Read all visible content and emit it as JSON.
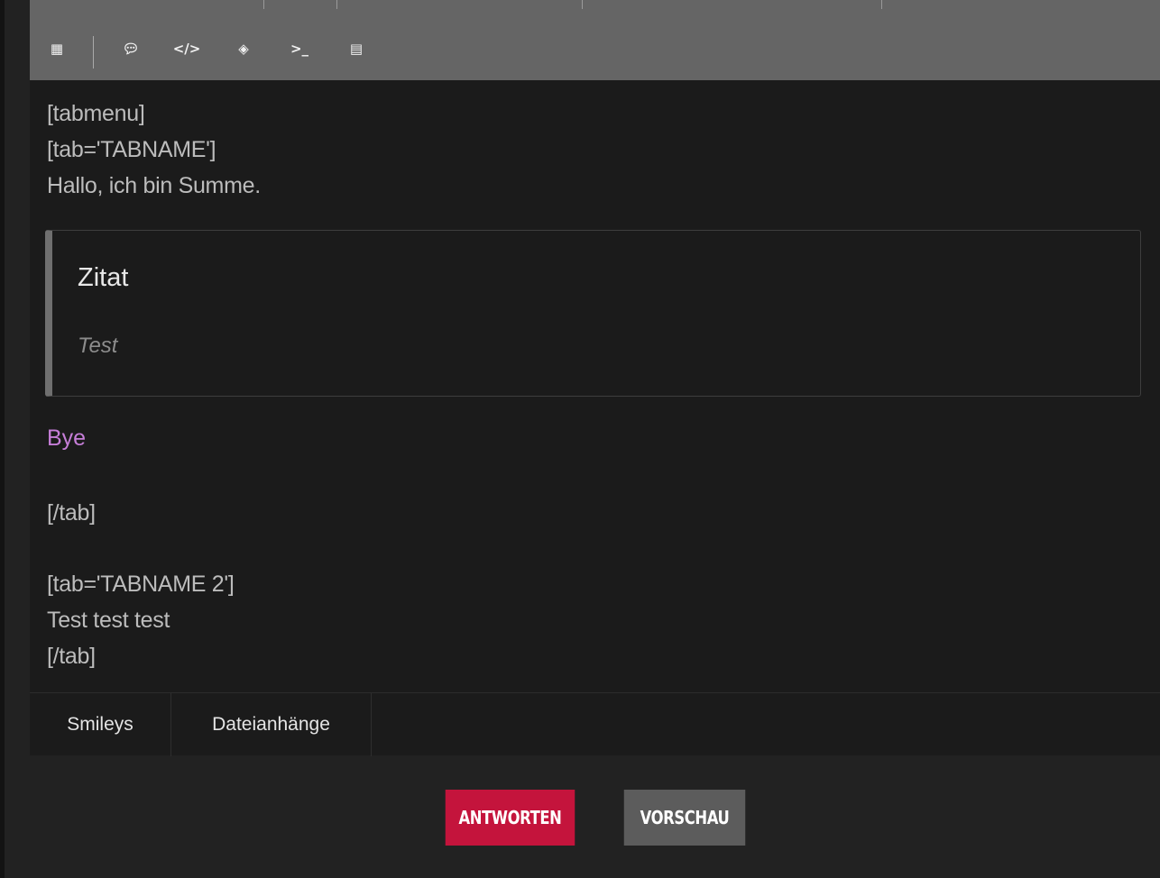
{
  "toolbar_icons": [
    {
      "name": "table-icon",
      "glyph": "▦"
    },
    {
      "name": "speech-bubble-icon",
      "glyph": "💬︎"
    },
    {
      "name": "code-icon",
      "glyph": "</>"
    },
    {
      "name": "eye-slash-icon",
      "glyph": "◈"
    },
    {
      "name": "terminal-icon",
      "glyph": ">_"
    },
    {
      "name": "newspaper-icon",
      "glyph": "▤"
    }
  ],
  "content": {
    "line1": "[tabmenu]",
    "line2": "[tab='TABNAME']",
    "line3": "Hallo, ich bin Summe.",
    "quote_title": "Zitat",
    "quote_body": "Test",
    "bye": "Bye",
    "line_tab_close1": "[/tab]",
    "line_tab2": "[tab='TABNAME 2']",
    "line_test": "Test test test",
    "line_tab_close2": "[/tab]"
  },
  "editor_tabs": {
    "smileys": "Smileys",
    "attachments": "Dateianhänge"
  },
  "actions": {
    "reply": "ANTWORTEN",
    "preview": "VORSCHAU"
  },
  "colors": {
    "accent": "#c4143c",
    "bye_text": "#c67ed8",
    "toolbar": "#656565"
  }
}
